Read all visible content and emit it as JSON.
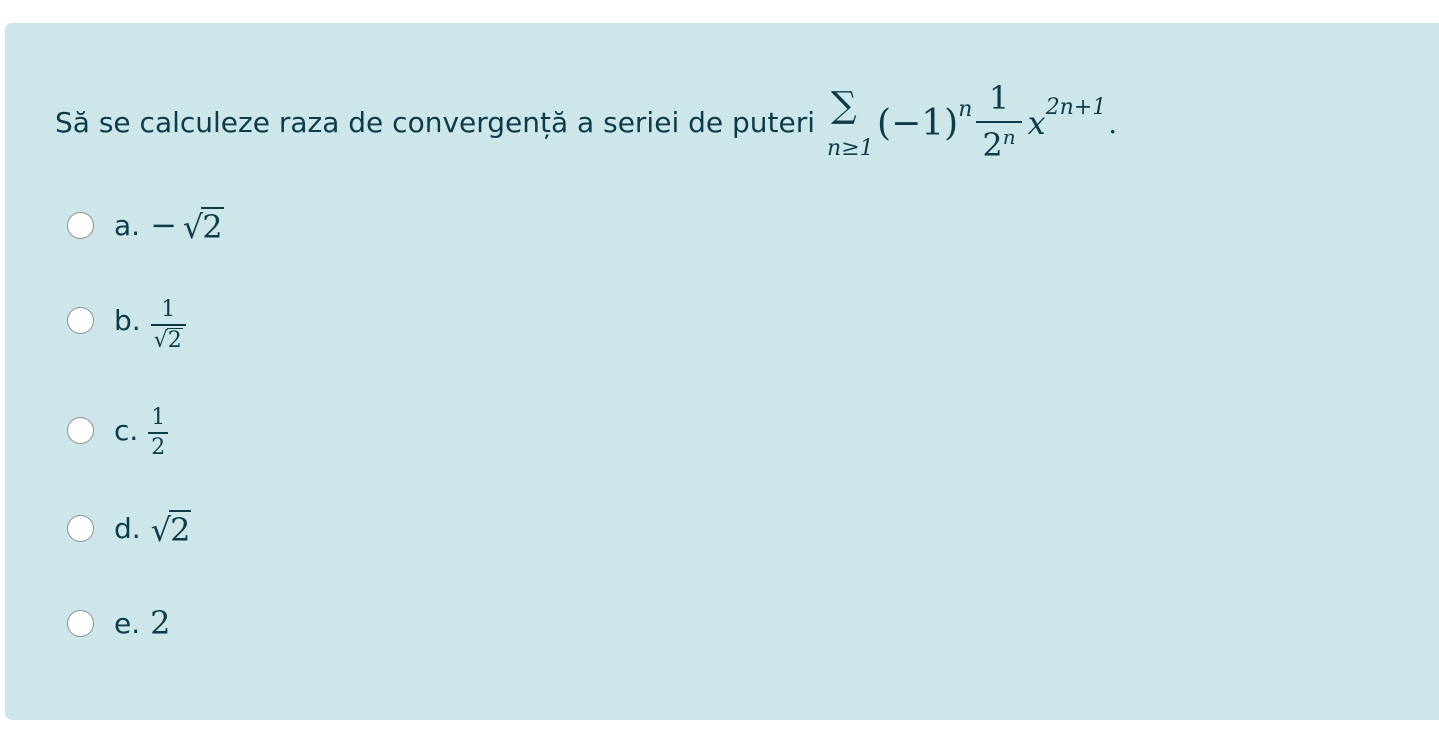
{
  "question": {
    "prompt": "Să se calculeze raza de convergență a seriei de puteri",
    "sum_symbol": "∑",
    "sum_subscript": "n≥1",
    "factor_open": "(−1)",
    "factor_exp": "n",
    "frac_num": "1",
    "frac_den_base": "2",
    "frac_den_exp": "n",
    "var": "x",
    "var_exp": "2n+1",
    "end": "."
  },
  "answers": [
    {
      "letter": "a.",
      "minus": "−",
      "radical": "√",
      "value": "2"
    },
    {
      "letter": "b.",
      "num": "1",
      "radical": "√",
      "den": "2"
    },
    {
      "letter": "c.",
      "num": "1",
      "den": "2"
    },
    {
      "letter": "d.",
      "radical": "√",
      "value": "2"
    },
    {
      "letter": "e.",
      "value": "2"
    }
  ],
  "colors": {
    "card_background": "#cde6ea",
    "text": "#0c3c4a"
  }
}
